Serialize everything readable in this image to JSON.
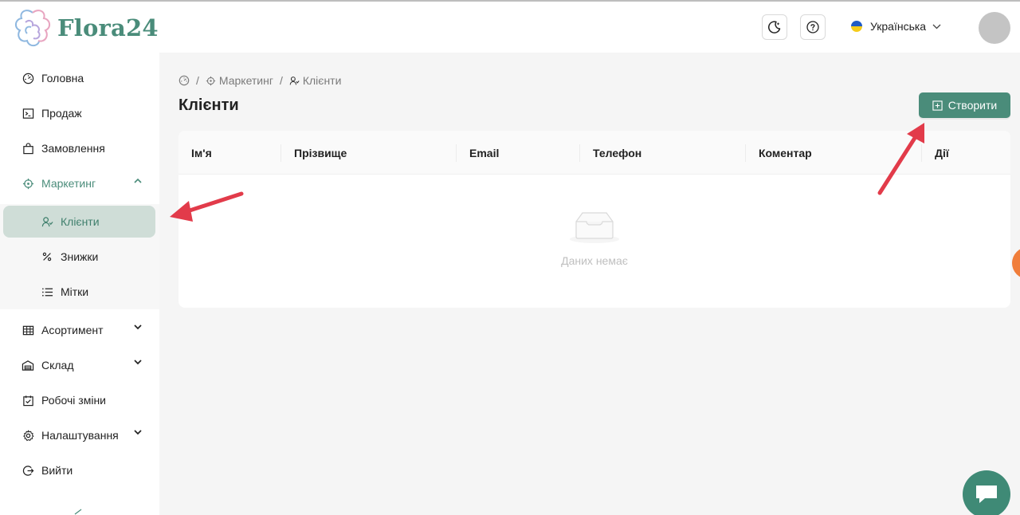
{
  "app": {
    "logo_text": "Flora24"
  },
  "header": {
    "theme_icon": "moon-icon",
    "help_icon": "question-circle-icon",
    "language": "Українська",
    "language_icon": "ukraine-flag-icon"
  },
  "sidebar": {
    "items": [
      {
        "label": "Головна",
        "icon": "dashboard-icon"
      },
      {
        "label": "Продаж",
        "icon": "terminal-icon"
      },
      {
        "label": "Замовлення",
        "icon": "shopping-bag-icon"
      },
      {
        "label": "Маркетинг",
        "icon": "aim-icon",
        "expanded": true
      },
      {
        "label": "Асортимент",
        "icon": "table-icon"
      },
      {
        "label": "Склад",
        "icon": "warehouse-icon"
      },
      {
        "label": "Робочі зміни",
        "icon": "calendar-check-icon"
      },
      {
        "label": "Налаштування",
        "icon": "gear-icon"
      },
      {
        "label": "Вийти",
        "icon": "logout-icon"
      }
    ],
    "marketing_sub": [
      {
        "label": "Клієнти",
        "icon": "users-icon",
        "selected": true
      },
      {
        "label": "Знижки",
        "icon": "percent-icon"
      },
      {
        "label": "Мітки",
        "icon": "list-icon"
      }
    ]
  },
  "breadcrumb": {
    "home_icon": "dashboard-icon",
    "separator": "/",
    "items": [
      "Маркетинг",
      "Клієнти"
    ]
  },
  "page": {
    "title": "Клієнти",
    "create_label": "Створити"
  },
  "table": {
    "columns": [
      "Ім'я",
      "Прізвище",
      "Email",
      "Телефон",
      "Коментар",
      "Дії"
    ],
    "empty_text": "Даних немає"
  },
  "colors": {
    "brand": "#4a8c7a",
    "selected_bg": "#cfddd7",
    "annotation_arrow": "#e23b4a",
    "chat": "#3f8a76"
  }
}
